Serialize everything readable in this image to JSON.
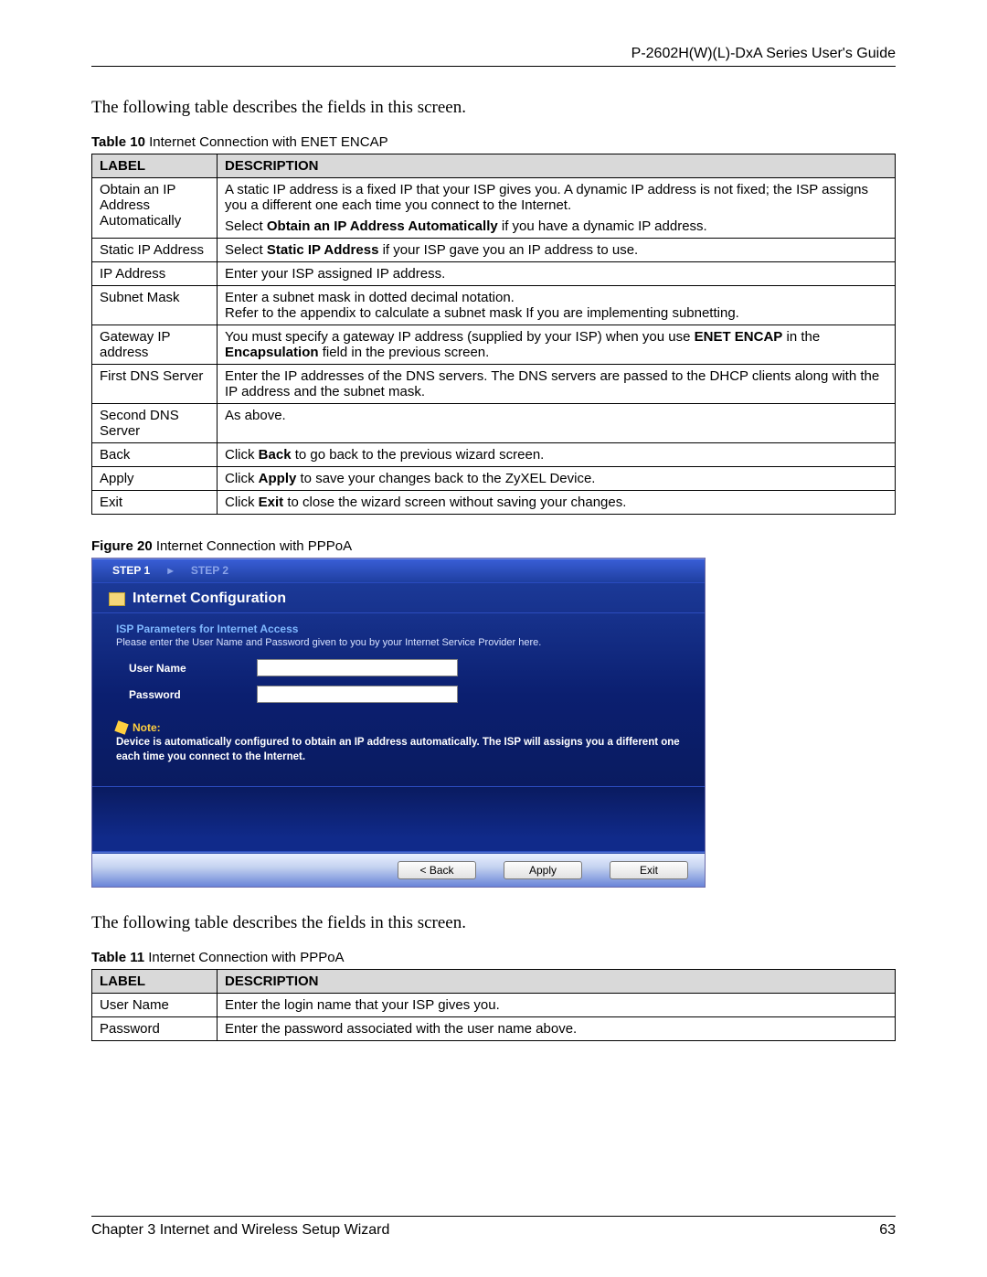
{
  "header": {
    "title": "P-2602H(W)(L)-DxA Series User's Guide"
  },
  "intro1": "The following table describes the fields in this screen.",
  "table10": {
    "caption_bold": "Table 10",
    "caption_rest": "   Internet Connection with ENET ENCAP",
    "head_label": "LABEL",
    "head_desc": "DESCRIPTION",
    "rows": [
      {
        "label": "Obtain an IP Address Automatically",
        "desc_plain1": "A static IP address is a fixed IP that your ISP gives you. A dynamic IP address is not fixed; the ISP assigns you a different one each time you connect to the Internet.",
        "desc_pre2": "Select ",
        "desc_bold2": "Obtain an IP Address Automatically",
        "desc_post2": " if you have a dynamic IP address."
      },
      {
        "label": "Static IP Address",
        "desc_pre": "Select ",
        "desc_bold": "Static IP Address",
        "desc_post": " if your ISP gave you an IP address to use."
      },
      {
        "label": "IP Address",
        "desc": "Enter your ISP assigned IP address."
      },
      {
        "label": "Subnet Mask",
        "desc1": "Enter a subnet mask in dotted decimal notation.",
        "desc2": "Refer to the appendix to calculate a subnet mask If you are implementing subnetting."
      },
      {
        "label": "Gateway IP address",
        "desc_pre": "You must specify a gateway IP address (supplied by your ISP) when you use ",
        "desc_bold1": "ENET ENCAP",
        "desc_mid": " in the ",
        "desc_bold2": "Encapsulation",
        "desc_post": " field in the previous screen."
      },
      {
        "label": "First DNS Server",
        "desc": "Enter the IP addresses of the DNS servers. The DNS servers are passed to the DHCP clients along with the IP address and the subnet mask."
      },
      {
        "label": "Second DNS Server",
        "desc": "As above."
      },
      {
        "label": "Back",
        "desc_pre": "Click ",
        "desc_bold": "Back",
        "desc_post": " to go back to the previous wizard screen."
      },
      {
        "label": "Apply",
        "desc_pre": "Click ",
        "desc_bold": "Apply",
        "desc_post": " to save your changes back to the ZyXEL Device."
      },
      {
        "label": "Exit",
        "desc_pre": "Click ",
        "desc_bold": "Exit",
        "desc_post": " to close the wizard screen without saving your changes."
      }
    ]
  },
  "figure20": {
    "caption_bold": "Figure 20",
    "caption_rest": "   Internet Connection with PPPoA",
    "step1": "STEP 1",
    "step_sep": "▸",
    "step2": "STEP 2",
    "section_title": "Internet Configuration",
    "isp_title": "ISP Parameters for Internet Access",
    "isp_sub": "Please enter the User Name and Password given to you by your Internet Service Provider here.",
    "field_user": "User Name",
    "field_pass": "Password",
    "note_title": "Note:",
    "note_text": "Device is automatically configured to obtain an IP address automatically. The ISP will assigns you a different one each time you connect to the Internet.",
    "btn_back": "< Back",
    "btn_apply": "Apply",
    "btn_exit": "Exit"
  },
  "intro2": "The following table describes the fields in this screen.",
  "table11": {
    "caption_bold": "Table 11",
    "caption_rest": "   Internet Connection with PPPoA",
    "head_label": "LABEL",
    "head_desc": "DESCRIPTION",
    "rows": [
      {
        "label": "User Name",
        "desc": "Enter the login name that your ISP gives you."
      },
      {
        "label": "Password",
        "desc": "Enter the password associated with the user name above."
      }
    ]
  },
  "footer": {
    "chapter": "Chapter 3 Internet and Wireless Setup Wizard",
    "page": "63"
  }
}
